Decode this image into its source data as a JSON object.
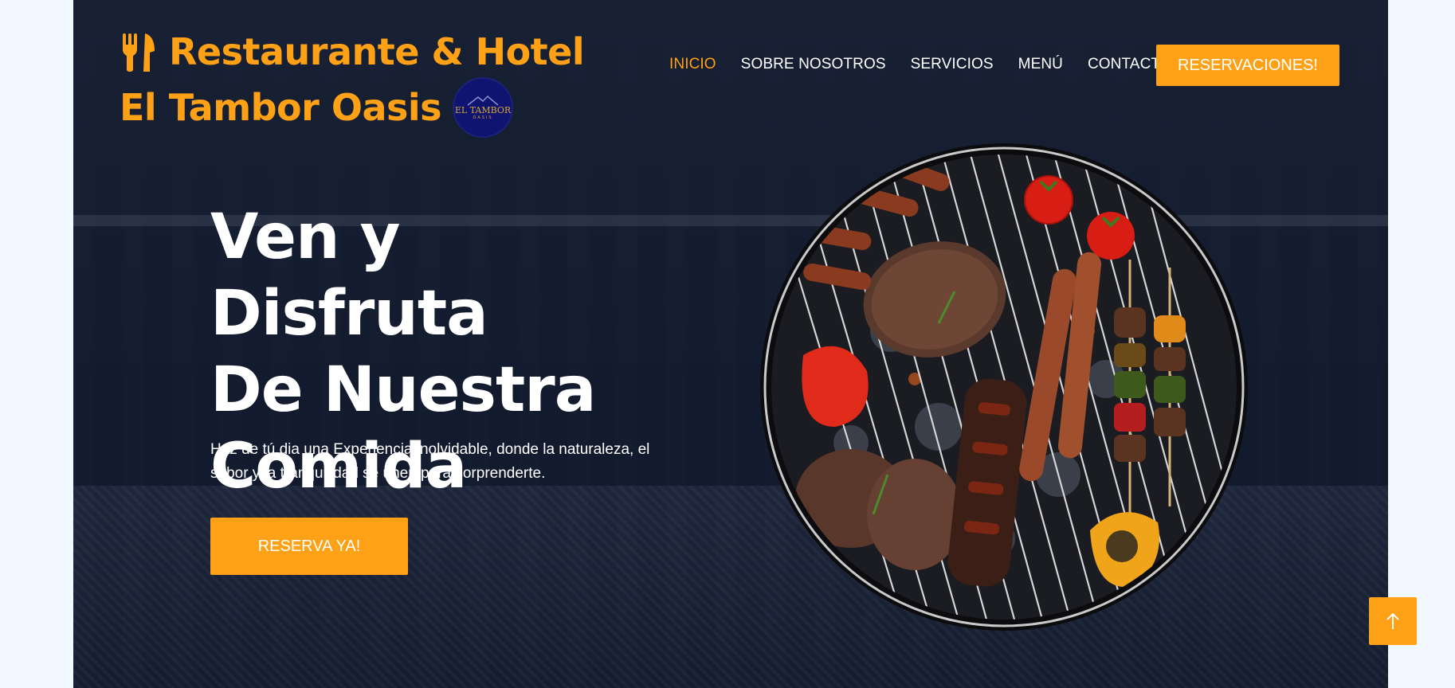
{
  "brand": {
    "line1": "Restaurante & Hotel",
    "line2": "El Tambor Oasis",
    "logo_text": "EL TAMBOR",
    "logo_sub": "OASIS",
    "icon": "utensils-icon"
  },
  "nav": {
    "items": [
      {
        "label": "INICIO",
        "active": true
      },
      {
        "label": "SOBRE NOSOTROS"
      },
      {
        "label": "SERVICIOS"
      },
      {
        "label": "MENÚ"
      },
      {
        "label": "CONTACTO"
      }
    ],
    "cta": "RESERVACIONES!"
  },
  "hero": {
    "headline_1": "Ven y Disfruta",
    "headline_2": "De Nuestra",
    "headline_3": "Comida",
    "subtitle": "Haz de tú dia una Experiencia inolvidable, donde la naturaleza, el sabor y la tranquilidad se unen para sorprenderte.",
    "button": "RESERVA YA!"
  },
  "back_to_top": {
    "icon": "arrow-up-icon"
  },
  "colors": {
    "accent": "#fea116",
    "dark": "#0f172b",
    "light": "#f1f8ff"
  }
}
